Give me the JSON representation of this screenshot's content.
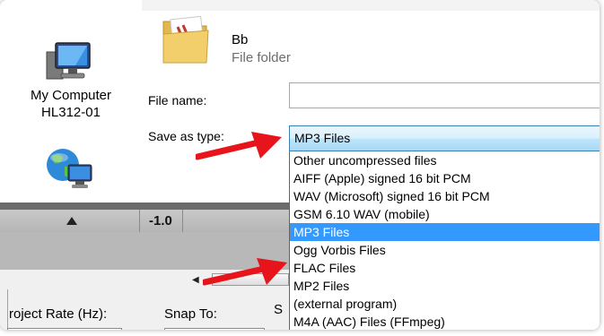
{
  "sidebar": {
    "computer_label": "My Computer",
    "computer_name": "HL312-01"
  },
  "folder": {
    "name": "Bb",
    "type": "File folder"
  },
  "form": {
    "file_name_label": "File name:",
    "file_name_value": "",
    "save_as_type_label": "Save as type:",
    "save_as_type_value": "MP3 Files"
  },
  "type_options": [
    "Other uncompressed files",
    "AIFF (Apple) signed 16 bit PCM",
    "WAV (Microsoft) signed 16 bit PCM",
    "GSM 6.10 WAV (mobile)",
    "MP3 Files",
    "Ogg Vorbis Files",
    "FLAC Files",
    "MP2 Files",
    "(external program)",
    "M4A (AAC) Files (FFmpeg)"
  ],
  "selected_option": "MP3 Files",
  "audacity": {
    "ruler_value": "-1.0",
    "project_rate_label": "roject Rate (Hz):",
    "snap_to_label": "Snap To:",
    "partial_label": "S"
  },
  "colors": {
    "selection": "#3399ff",
    "arrow": "#e8141b"
  }
}
